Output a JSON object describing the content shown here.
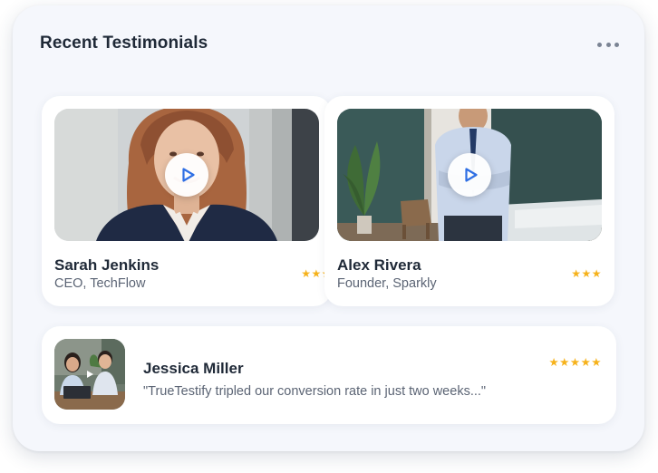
{
  "widget": {
    "title": "Recent Testimonials",
    "menu_icon": "more-horizontal-icon"
  },
  "testimonials": [
    {
      "name": "Sarah Jenkins",
      "role": "CEO, TechFlow",
      "stars": "★★★",
      "rating": 3,
      "media": "video",
      "play_icon": "play-icon"
    },
    {
      "name": "Alex Rivera",
      "role": "Founder, Sparkly",
      "stars": "★★★",
      "rating": 3,
      "media": "video",
      "play_icon": "play-icon"
    }
  ],
  "featured": {
    "name": "Jessica Miller",
    "quote": "\"TrueTestify tripled our conversion rate in just two weeks...\"",
    "stars": "★★★★★",
    "rating": 5,
    "play_icon": "play-icon"
  },
  "colors": {
    "accent": "#2f6fe4",
    "star": "#f6b21b",
    "heading": "#1f2937",
    "muted": "#5b6474",
    "background": "#f5f7fc"
  }
}
